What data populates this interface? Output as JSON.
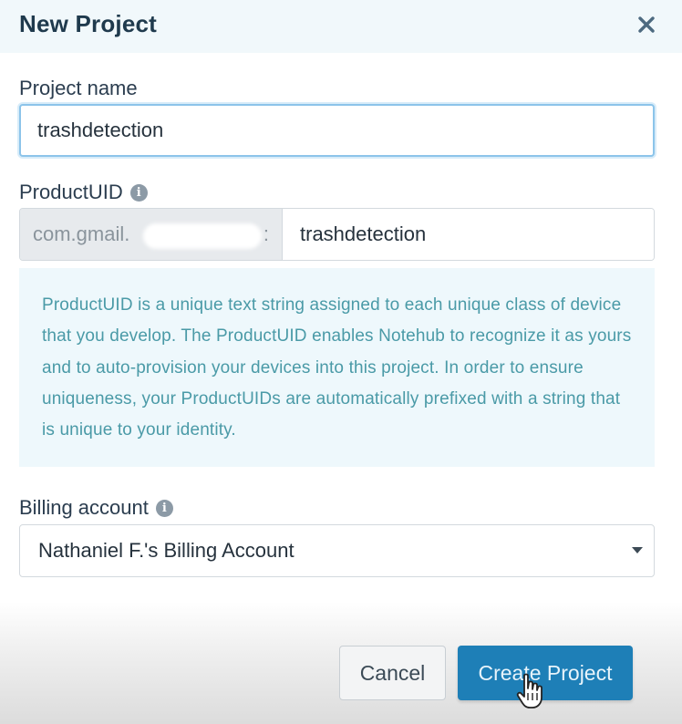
{
  "dialog": {
    "title": "New Project",
    "close_icon": "close-icon"
  },
  "project_name": {
    "label": "Project name",
    "value": "trashdetection"
  },
  "product_uid": {
    "label": "ProductUID",
    "info_icon": "info-icon",
    "prefix": "com.gmail.",
    "separator": ":",
    "value": "trashdetection",
    "help_text": "ProductUID is a unique text string assigned to each unique class of device that you develop. The ProductUID enables Notehub to recognize it as yours and to auto-provision your devices into this project. In order to ensure uniqueness, your ProductUIDs are automatically prefixed with a string that is unique to your identity."
  },
  "billing": {
    "label": "Billing account",
    "info_icon": "info-icon",
    "selected": "Nathaniel F.'s Billing Account"
  },
  "actions": {
    "cancel": "Cancel",
    "create": "Create Project"
  },
  "colors": {
    "primary": "#1e7fb7",
    "help_text": "#4a9aa7",
    "help_bg": "#eef8fc"
  }
}
